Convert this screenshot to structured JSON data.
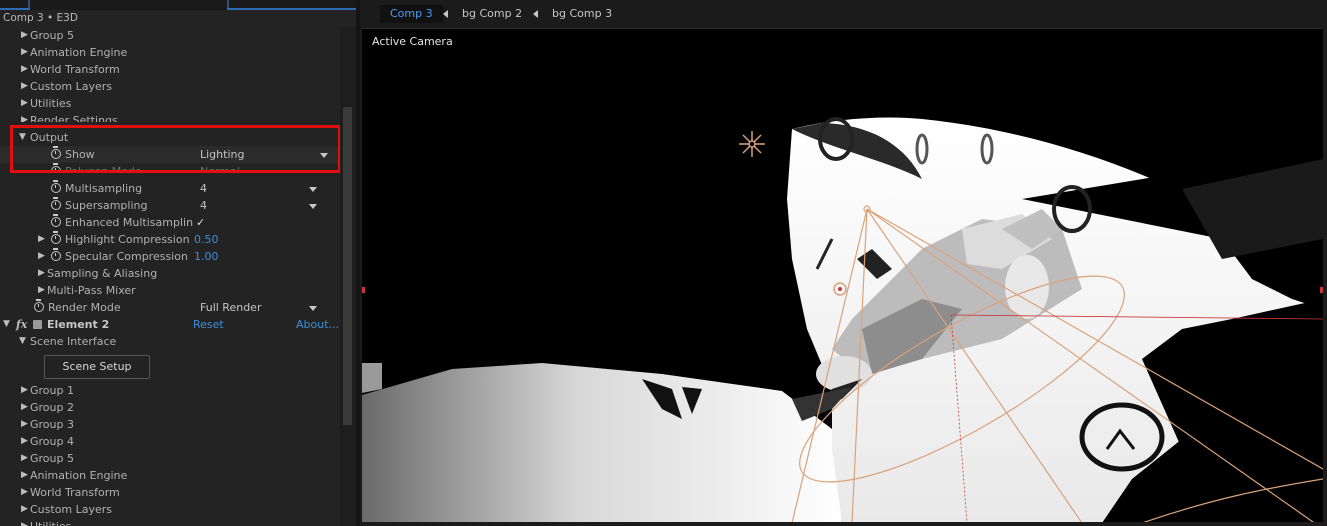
{
  "panel": {
    "title": "Comp 3 • E3D",
    "rows_top": [
      {
        "label": "Group 5"
      },
      {
        "label": "Animation Engine"
      },
      {
        "label": "World Transform"
      },
      {
        "label": "Custom Layers"
      },
      {
        "label": "Utilities"
      },
      {
        "label": "Render Settings"
      }
    ],
    "output": {
      "label": "Output",
      "show": {
        "label": "Show",
        "value": "Lighting"
      },
      "polygon_mode": {
        "label": "Polygon Mode",
        "value": "Normal"
      },
      "multisampling": {
        "label": "Multisampling",
        "value": "4"
      },
      "supersampling": {
        "label": "Supersampling",
        "value": "4"
      },
      "enhanced_multisampling": {
        "label": "Enhanced Multisamplin",
        "value": "✓"
      },
      "highlight_compression": {
        "label": "Highlight Compression",
        "value": "0.50"
      },
      "specular_compression": {
        "label": "Specular Compression",
        "value": "1.00"
      },
      "sampling_aliasing": {
        "label": "Sampling & Aliasing"
      },
      "multipass_mixer": {
        "label": "Multi-Pass Mixer"
      }
    },
    "render_mode": {
      "label": "Render Mode",
      "value": "Full Render"
    },
    "element2": {
      "fx": "fx",
      "label": "Element 2",
      "reset": "Reset",
      "about": "About..."
    },
    "scene_interface": {
      "label": "Scene Interface",
      "button": "Scene Setup"
    },
    "rows_bottom": [
      {
        "label": "Group 1"
      },
      {
        "label": "Group 2"
      },
      {
        "label": "Group 3"
      },
      {
        "label": "Group 4"
      },
      {
        "label": "Group 5"
      },
      {
        "label": "Animation Engine"
      },
      {
        "label": "World Transform"
      },
      {
        "label": "Custom Layers"
      },
      {
        "label": "Utilities"
      }
    ]
  },
  "viewer": {
    "tabs": [
      "Comp 3",
      "bg Comp 2",
      "bg Comp 3"
    ],
    "active_tab": "Comp 3",
    "camera_label": "Active Camera"
  },
  "colors": {
    "accent_blue": "#3d8fd8",
    "highlight_red": "#e01010",
    "guide_orange": "#d9a27a"
  }
}
